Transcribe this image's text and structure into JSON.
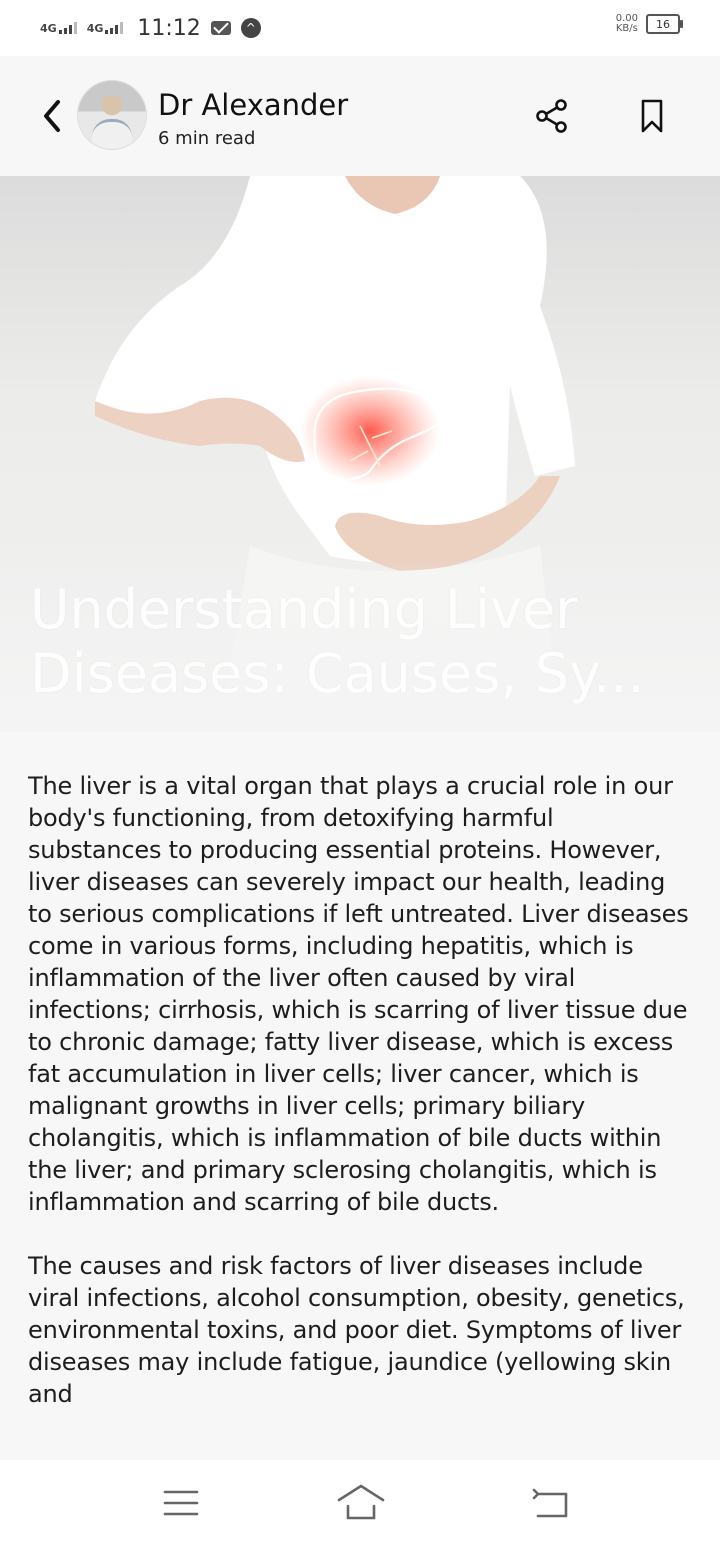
{
  "status_bar": {
    "network_1": "4G",
    "network_2": "4G",
    "time": "11:12",
    "speed_value": "0.00",
    "speed_unit": "KB/s",
    "battery": "16"
  },
  "header": {
    "author_name": "Dr Alexander",
    "read_time": "6 min read"
  },
  "hero": {
    "title": "Understanding Liver Diseases: Causes, Sy..."
  },
  "article": {
    "paragraphs": [
      "The liver is a vital organ that plays a crucial role in our body's functioning, from detoxifying harmful substances to producing essential proteins. However, liver diseases can severely impact our health, leading to serious complications if left untreated. Liver diseases come in various forms, including hepatitis, which is inflammation of the liver often caused by viral infections; cirrhosis, which is scarring of liver tissue due to chronic damage; fatty liver disease, which is excess fat accumulation in liver cells; liver cancer, which is malignant growths in liver cells; primary biliary cholangitis, which is inflammation of bile ducts within the liver; and primary sclerosing cholangitis, which is inflammation and scarring of bile ducts.",
      "The causes and risk factors of liver diseases include viral infections, alcohol consumption, obesity, genetics, environmental toxins, and poor diet. Symptoms of liver diseases may include fatigue, jaundice (yellowing skin and"
    ]
  },
  "icons": {
    "back": "chevron-left-icon",
    "share": "share-icon",
    "bookmark": "bookmark-icon",
    "menu": "menu-icon",
    "home": "home-icon",
    "nav_back": "return-icon"
  },
  "colors": {
    "background": "#f7f7f7",
    "liver_glow": "#ff4a3d"
  }
}
